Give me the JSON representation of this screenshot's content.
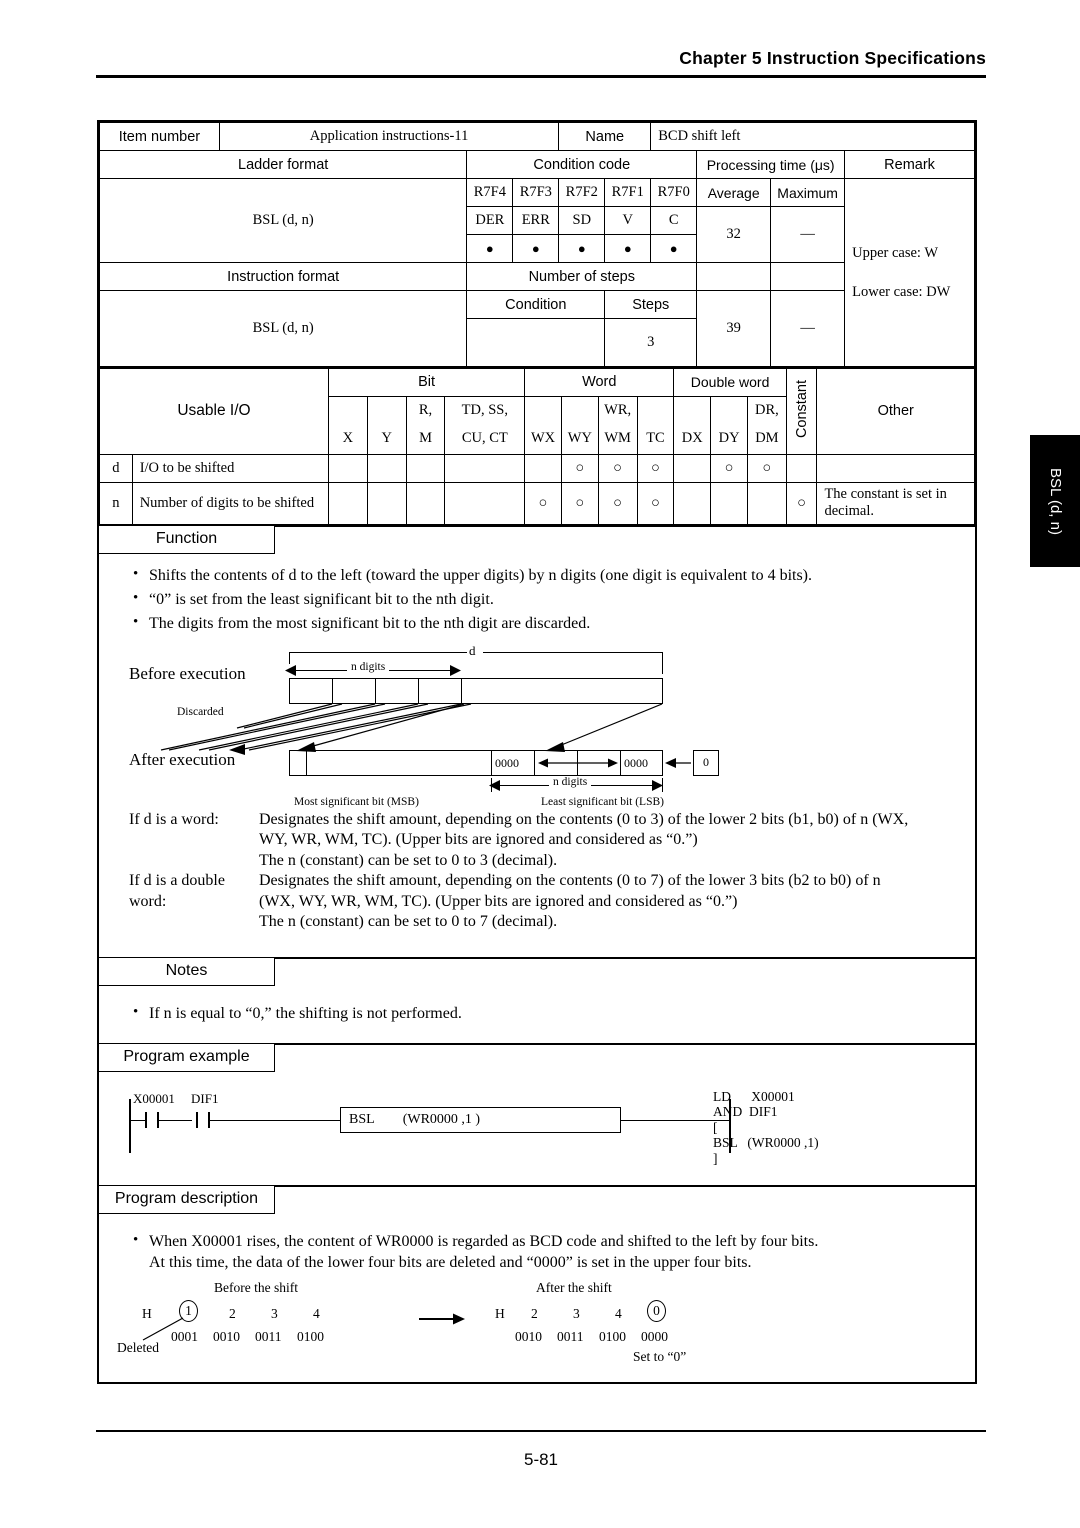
{
  "header": {
    "chapter": "Chapter 5  Instruction Specifications"
  },
  "spec": {
    "item_number_label": "Item number",
    "item_number_value": "Application instructions-11",
    "name_label": "Name",
    "name_value": "BCD shift left",
    "ladder_format_label": "Ladder format",
    "condition_code_label": "Condition code",
    "processing_time_label": "Processing time (μs)",
    "remark_label": "Remark",
    "registers": [
      "R7F4",
      "R7F3",
      "R7F2",
      "R7F1",
      "R7F0"
    ],
    "flags": [
      "DER",
      "ERR",
      "SD",
      "V",
      "C"
    ],
    "flag_marks": [
      "●",
      "●",
      "●",
      "●",
      "●"
    ],
    "average_label": "Average",
    "maximum_label": "Maximum",
    "ladder_mnemonic": "BSL (d, n)",
    "average_value_1": "32",
    "maximum_value_1": "—",
    "remark_line1": "Upper case: W",
    "remark_line2": "Lower case: DW",
    "instruction_format_label": "Instruction format",
    "number_of_steps_label": "Number of steps",
    "condition_label": "Condition",
    "steps_label": "Steps",
    "instruction_mnemonic": "BSL (d, n)",
    "condition_value": "",
    "steps_value": "3",
    "average_value_2": "39",
    "maximum_value_2": "—"
  },
  "usable_io": {
    "title": "Usable I/O",
    "group_bit": "Bit",
    "group_word": "Word",
    "group_dword": "Double word",
    "group_constant": "Constant",
    "group_other": "Other",
    "columns": [
      {
        "top": "",
        "bottom": "X"
      },
      {
        "top": "",
        "bottom": "Y"
      },
      {
        "top": "R,",
        "bottom": "M"
      },
      {
        "top": "TD, SS,",
        "bottom": "CU, CT"
      },
      {
        "top": "",
        "bottom": "WX"
      },
      {
        "top": "",
        "bottom": "WY"
      },
      {
        "top": "WR,",
        "bottom": "WM"
      },
      {
        "top": "",
        "bottom": "TC"
      },
      {
        "top": "",
        "bottom": "DX"
      },
      {
        "top": "",
        "bottom": "DY"
      },
      {
        "top": "DR,",
        "bottom": "DM"
      }
    ],
    "rows": [
      {
        "key": "d",
        "desc": "I/O to be shifted",
        "marks": [
          "",
          "",
          "",
          "",
          "",
          "○",
          "○",
          "○",
          "",
          "○",
          "○"
        ],
        "constant": "",
        "other": ""
      },
      {
        "key": "n",
        "desc": "Number of digits to be shifted",
        "marks": [
          "",
          "",
          "",
          "",
          "○",
          "○",
          "○",
          "○",
          "",
          "",
          ""
        ],
        "constant": "○",
        "other": "The constant is set in decimal."
      }
    ]
  },
  "function": {
    "tab": "Function",
    "bullets": [
      "Shifts the contents of d to the left (toward the upper digits) by n digits (one digit is equivalent to 4 bits).",
      "“0” is set from the least significant bit to the nth digit.",
      "The digits from the most significant bit to the nth digit are discarded."
    ],
    "diagram": {
      "before_label": "Before execution",
      "after_label": "After execution",
      "d_label": "d",
      "n_digits_label": "n digits",
      "discarded_label": "Discarded",
      "zeros_left": "0000",
      "zeros_right": "0000",
      "zero_source": "0",
      "msb_label": "Most significant bit (MSB)",
      "lsb_label": "Least significant bit (LSB)"
    },
    "explanations": [
      {
        "label": "If d is a word:",
        "lines": [
          "Designates the shift amount, depending on the contents (0 to 3) of the lower 2 bits (b1, b0) of n (WX,",
          "WY, WR, WM, TC).  (Upper bits are ignored and considered as “0.”)",
          "The n (constant) can be set to 0 to 3 (decimal)."
        ]
      },
      {
        "label": "If d is a double word:",
        "lines": [
          "Designates the shift amount, depending on the contents (0 to 7) of the lower 3 bits (b2 to b0) of n",
          "(WX, WY, WR, WM, TC).  (Upper bits are ignored and considered as “0.”)",
          "The n (constant) can be set to 0 to 7 (decimal)."
        ]
      }
    ]
  },
  "notes": {
    "tab": "Notes",
    "bullets": [
      "If n is equal to “0,” the shifting is not performed."
    ]
  },
  "program_example": {
    "tab": "Program example",
    "ladder": {
      "contact1": "X00001",
      "contact2": "DIF1",
      "box_op": "BSL",
      "box_args": "(WR0000 ,1  )"
    },
    "mnemonic": "LD      X00001\nAND  DIF1\n[\nBSL   (WR0000 ,1)\n]"
  },
  "program_description": {
    "tab": "Program description",
    "bullets": [
      "When X00001 rises, the content of WR0000 is regarded as BCD code and shifted to the left by four bits.\nAt this time, the data of the lower four bits are deleted and “0000” is set in the upper four bits."
    ],
    "bcd": {
      "before_title": "Before the shift",
      "after_title": "After the shift",
      "h_left": "H",
      "h_right": "H",
      "before_digits": [
        "1",
        "2",
        "3",
        "4"
      ],
      "before_bits": [
        "0001",
        "0010",
        "0011",
        "0100"
      ],
      "after_digits": [
        "2",
        "3",
        "4",
        "0"
      ],
      "after_bits": [
        "0010",
        "0011",
        "0100",
        "0000"
      ],
      "deleted_label": "Deleted",
      "set_to_zero_label": "Set to “0”"
    }
  },
  "side_tab": {
    "label": "BSL (d, n)"
  },
  "footer": {
    "page_number": "5-81"
  }
}
